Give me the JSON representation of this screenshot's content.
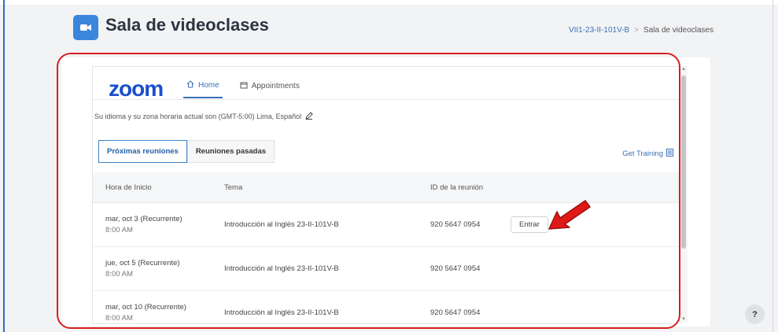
{
  "header": {
    "title": "Sala de videoclases",
    "breadcrumb": {
      "course": "VII1-23-II-101V-B",
      "current": "Sala de videoclases"
    }
  },
  "zoom": {
    "logo": "zoom",
    "nav": {
      "home": "Home",
      "appointments": "Appointments"
    },
    "language_note": "Su idioma y su zona horaria actual son (GMT-5:00) Lima, Español",
    "tabs": {
      "upcoming": "Próximas reuniones",
      "past": "Reuniones pasadas"
    },
    "get_training": "Get Training",
    "columns": {
      "start": "Hora de Inicio",
      "topic": "Tema",
      "id": "ID de la reunión"
    },
    "meetings": [
      {
        "date": "mar, oct 3 (Recurrente)",
        "time": "8:00 AM",
        "topic": "Introducción al Inglés 23-II-101V-B",
        "id": "920 5647 0954",
        "action": "Entrar"
      },
      {
        "date": "jue, oct 5 (Recurrente)",
        "time": "8:00 AM",
        "topic": "Introducción al Inglés 23-II-101V-B",
        "id": "920 5647 0954",
        "action": ""
      },
      {
        "date": "mar, oct 10 (Recurrente)",
        "time": "8:00 AM",
        "topic": "Introducción al Inglés 23-II-101V-B",
        "id": "920 5647 0954",
        "action": ""
      }
    ]
  },
  "help": {
    "label": "?"
  },
  "colors": {
    "accent": "#3a70b8",
    "zoom_blue": "#1a4fcc",
    "annotation_red": "#d62020"
  }
}
